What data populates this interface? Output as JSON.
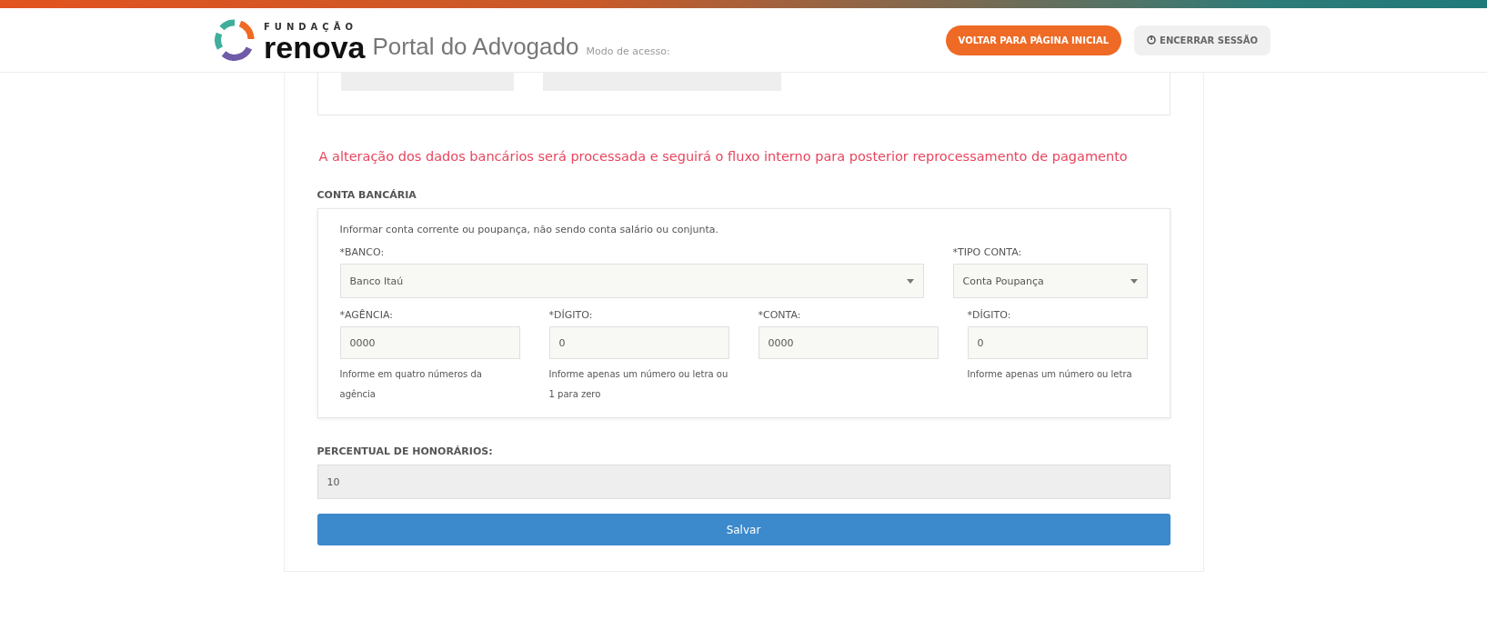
{
  "header": {
    "logo_small": "FUNDAÇÃO",
    "logo_big": "renova",
    "title": "Portal do Advogado",
    "mode": "Modo de acesso:",
    "buttons": [
      {
        "label": "VOLTAR PARA PÁGINA INICIAL",
        "kind": "primary"
      },
      {
        "label": "ENCERRAR SESSÃO",
        "kind": "logout"
      }
    ]
  },
  "notice": "A alteração dos dados bancários será processada e seguirá o fluxo interno para posterior reprocessamento de pagamento",
  "bank_section": {
    "title": "CONTA BANCÁRIA",
    "hint": "Informar conta corrente ou poupança, não sendo conta salário ou conjunta.",
    "selects": [
      {
        "label": "*BANCO:",
        "value": "Banco Itaú"
      },
      {
        "label": "*TIPO CONTA:",
        "value": "Conta Poupança"
      }
    ],
    "fields": [
      {
        "label": "*AGÊNCIA:",
        "value": "0000",
        "help": "Informe em quatro números da agência"
      },
      {
        "label": "*DÍGITO:",
        "value": "0",
        "help": "Informe apenas um número ou letra ou 1 para zero"
      },
      {
        "label": "*CONTA:",
        "value": "0000"
      },
      {
        "label": "*DÍGITO:",
        "value": "0",
        "help": "Informe apenas um número ou letra"
      }
    ]
  },
  "fee": {
    "label": "PERCENTUAL DE HONORÁRIOS:",
    "value": "10",
    "disabled": true
  },
  "save_button": "Salvar"
}
